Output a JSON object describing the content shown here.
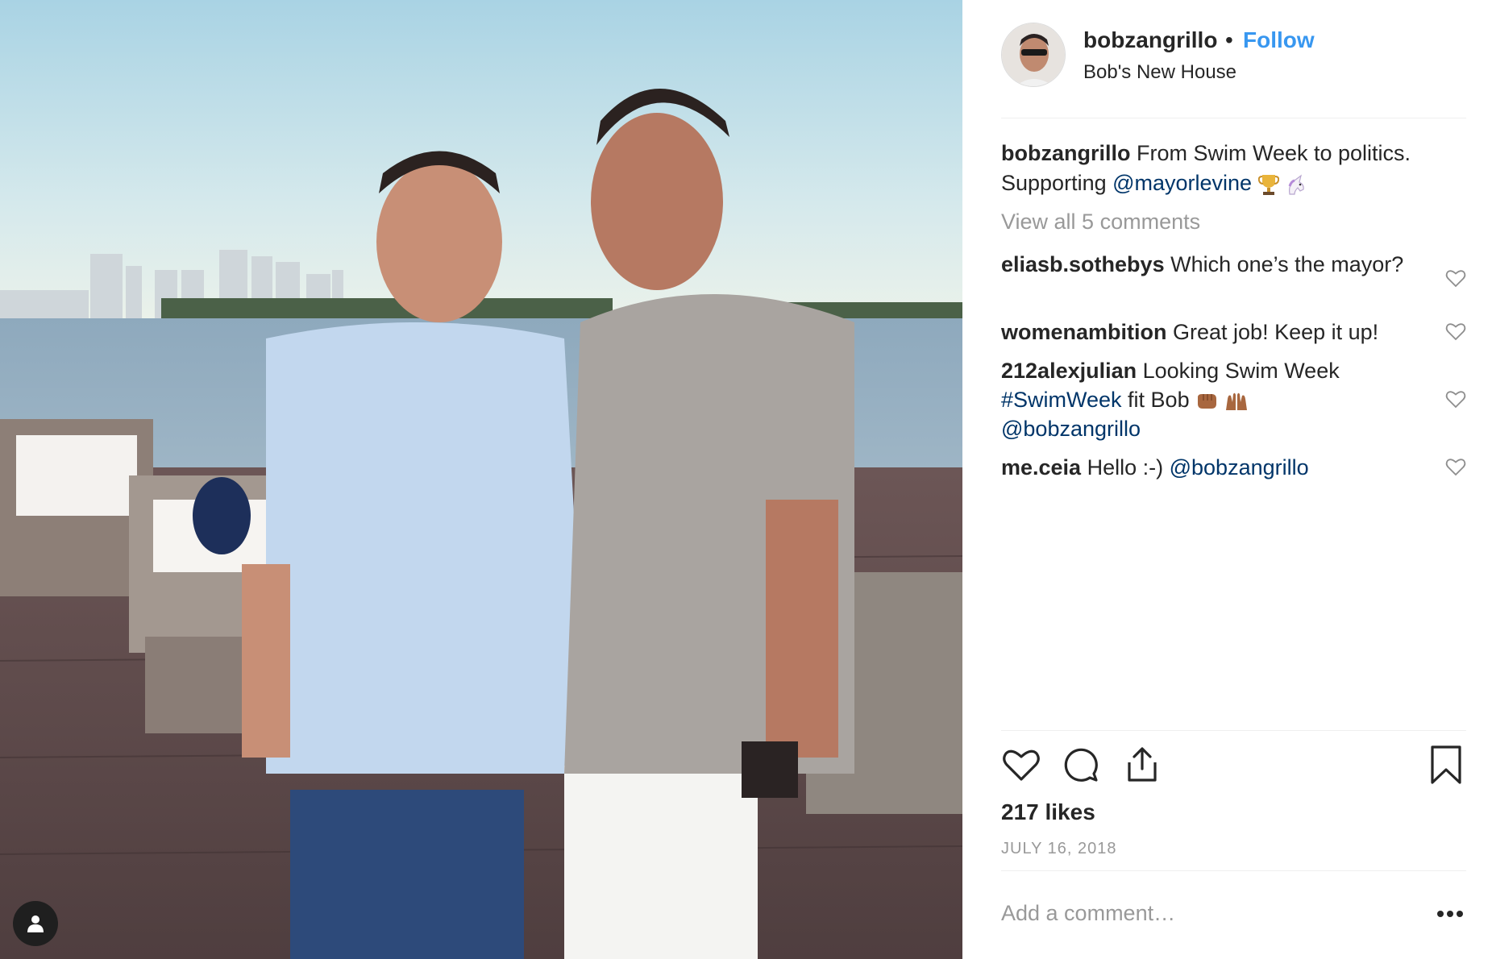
{
  "post": {
    "username": "bobzangrillo",
    "separator": "•",
    "follow_label": "Follow",
    "location": "Bob's New House"
  },
  "caption": {
    "username": "bobzangrillo",
    "text": " From Swim Week to politics. Supporting ",
    "mention": "@mayorlevine",
    "emojis": [
      "trophy-emoji",
      "unicorn-emoji"
    ]
  },
  "view_all_comments": "View all 5 comments",
  "comments": [
    {
      "username": "eliasb.sothebys",
      "text": " Which one’s the mayor?"
    },
    {
      "username": "womenambition",
      "text": " Great job! Keep it up!"
    },
    {
      "username": "212alexjulian",
      "text": " Looking Swim Week ",
      "hashtag": "#SwimWeek",
      "text2": " fit Bob ",
      "mention": "@bobzangrillo",
      "emojis": [
        "fist-bump-emoji",
        "raising-hands-emoji"
      ]
    },
    {
      "username": "me.ceia",
      "text": " Hello :-) ",
      "mention": "@bobzangrillo"
    }
  ],
  "likes": "217 likes",
  "date": "JULY 16, 2018",
  "add_comment_placeholder": "Add a comment…",
  "icons": {
    "like": "heart-icon",
    "comment": "comment-bubble-icon",
    "share": "share-icon",
    "save": "bookmark-icon",
    "more": "more-options-icon",
    "tag": "user-tag-icon"
  },
  "colors": {
    "follow": "#3897f0",
    "mention": "#003569",
    "muted": "#999999",
    "text": "#262626"
  }
}
